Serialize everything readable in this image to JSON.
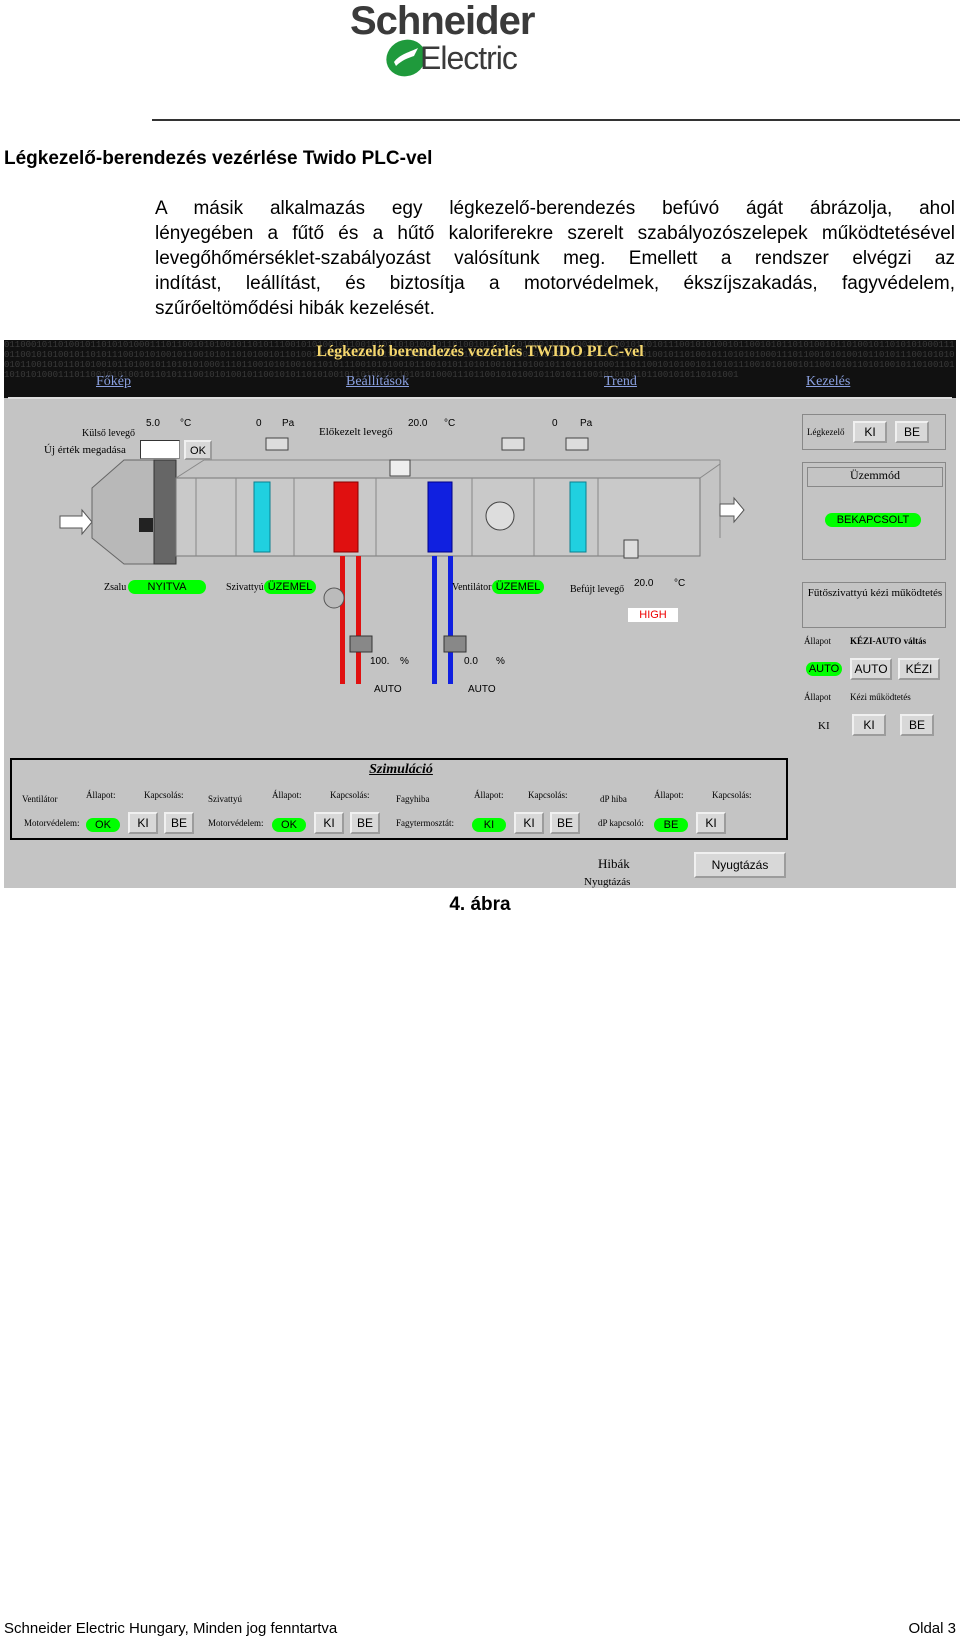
{
  "header": {
    "logo_line1": "Schneider",
    "logo_line2": "Electric"
  },
  "document": {
    "title": "Légkezelő-berendezés vezérlése Twido PLC-vel",
    "paragraph_lines": [
      "A másik alkalmazás egy légkezelő-berendezés befúvó ágát ábrázolja, ahol",
      "lényegében a fűtő és a hűtő kaloriferekre szerelt szabályozószelepek működtetésével",
      "levegőhőmérséklet-szabályozást valósítunk meg. Emellett a rendszer elvégzi az",
      "indítást, leállítást, és biztosítja a motorvédelmek, ékszíjszakadás, fagyvédelem,",
      "szűrőeltömődési hibák kezelését."
    ],
    "figure_caption": "4. ábra"
  },
  "hmi": {
    "title": "Légkezelő berendezés vezérlés TWIDO PLC-vel",
    "binary_text": "0110001011010010110101010001110110010101001011010111001010100101100101011010100101101001011010101000111011001010100101101011100101010010110010101101010010110100101101010100011101100101010010110101110010101001011001010110101001011010010110101010001110110010101001011010111001010100101100101011010100101101001011010101000111011001010100101101011100101010010110010101101010010110100101101010100011101100101010010110101110010101001011001010110101001011010010110101010001110110010101001011010111001010100101100101011010100101101001011010101000111011001010100101101011100101010010110010101101010010110100101101010100011101100101010010110101110010101001011001010110101001",
    "nav": [
      "Főkép",
      "Beállítások",
      "Trend",
      "Kezelés"
    ],
    "outside_air_label": "Külső levegő",
    "outside_air_value": "5.0",
    "outside_air_unit": "°C",
    "new_value_label": "Új érték megadása",
    "ok_button": "OK",
    "pressure1_value": "0",
    "pressure1_unit": "Pa",
    "preheated_label": "Előkezelt levegő",
    "preheated_value": "20.0",
    "preheated_unit": "°C",
    "pressure2_value": "0",
    "pressure2_unit": "Pa",
    "damper_label": "Zsalu",
    "damper_status": "NYITVA",
    "pump_label": "Szivattyú",
    "pump_status": "ÜZEMEL",
    "fan_label": "Ventilátor",
    "fan_status": "ÜZEMEL",
    "supply_air_label": "Befújt levegő",
    "supply_air_value": "20.0",
    "supply_air_unit": "°C",
    "alarm": "HIGH",
    "heat_valve_value": "100.",
    "heat_valve_unit": "%",
    "heat_valve_mode": "AUTO",
    "cool_valve_value": "0.0",
    "cool_valve_unit": "%",
    "cool_valve_mode": "AUTO",
    "right_panel": {
      "unit_label": "Légkezelő",
      "ki": "KI",
      "be": "BE",
      "mode_title": "Üzemmód",
      "mode_status": "BEKAPCSOLT",
      "pump_manual_title": "Fűtőszivattyú kézi működtetés",
      "state_label": "Állapot",
      "switch_label": "KÉZI-AUTO váltás",
      "auto_state": "AUTO",
      "auto_button": "AUTO",
      "kezi_button": "KÉZI",
      "state_label2": "Állapot",
      "manual_op_label": "Kézi működtetés",
      "ki_state": "KI",
      "ki_button": "KI",
      "be_button": "BE"
    },
    "simulation": {
      "title": "Szimuláció",
      "row1": [
        "Ventilátor",
        "Állapot:",
        "Kapcsolás:",
        "Szivattyú",
        "Állapot:",
        "Kapcsolás:",
        "Fagyhiba",
        "Állapot:",
        "Kapcsolás:",
        "dP hiba",
        "Állapot:",
        "Kapcsolás:"
      ],
      "row2_labels": [
        "Motorvédelem:",
        "Motorvédelem:",
        "Fagytermosztát:",
        "dP kapcsoló:"
      ],
      "row2_states": [
        "OK",
        "OK",
        "KI",
        "BE"
      ],
      "ki": "KI",
      "be": "BE"
    },
    "errors_label": "Hibák",
    "errors_sub": "Nyugtázás",
    "ack_button": "Nyugtázás"
  },
  "footer": {
    "left": "Schneider Electric Hungary, Minden jog fenntartva",
    "right": "Oldal 3"
  }
}
